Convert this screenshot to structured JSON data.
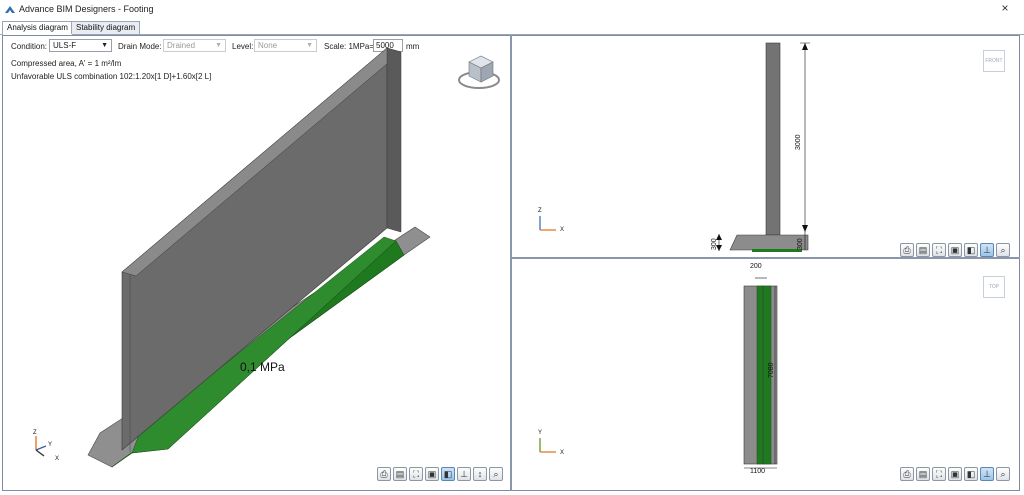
{
  "window": {
    "title": "Advance BIM Designers - Footing",
    "close_glyph": "×"
  },
  "tabs": [
    {
      "label": "Analysis diagram",
      "active": true
    },
    {
      "label": "Stability diagram",
      "active": false
    }
  ],
  "controls": {
    "condition_label": "Condition:",
    "condition_value": "ULS-F",
    "drain_mode_label": "Drain Mode:",
    "drain_mode_value": "Drained",
    "level_label": "Level:",
    "level_value": "None",
    "scale_label": "Scale: 1MPa=",
    "scale_value": "5000",
    "scale_unit": "mm"
  },
  "info": {
    "compressed_area": "Compressed area, A' = 1 m²/lm",
    "combination": "Unfavorable ULS combination 102:1.20x[1 D]+1.60x[2 L]"
  },
  "view3d": {
    "pressure_label": "0,1 MPa",
    "axes": {
      "z": "Z",
      "x": "X",
      "y": "Y"
    }
  },
  "front_view": {
    "tag": "FRONT",
    "dim_height": "3000",
    "dim_base": "300",
    "axes": {
      "z": "Z",
      "x": "X"
    }
  },
  "top_view": {
    "tag": "TOP",
    "dim_top": "200",
    "dim_length": "7080",
    "dim_bottom": "1100",
    "axes": {
      "y": "Y",
      "x": "X"
    }
  },
  "toolbar": {
    "buttons": [
      "print",
      "export",
      "fit",
      "zoom-window",
      "render-mode",
      "dimensions",
      "dimension-toggle",
      "zoom"
    ]
  },
  "colors": {
    "wall": "#696969",
    "wall_top": "#808080",
    "soil_pressure": "#1f7a1f",
    "footing": "#8f8f8f",
    "divider": "#8a96aa"
  }
}
